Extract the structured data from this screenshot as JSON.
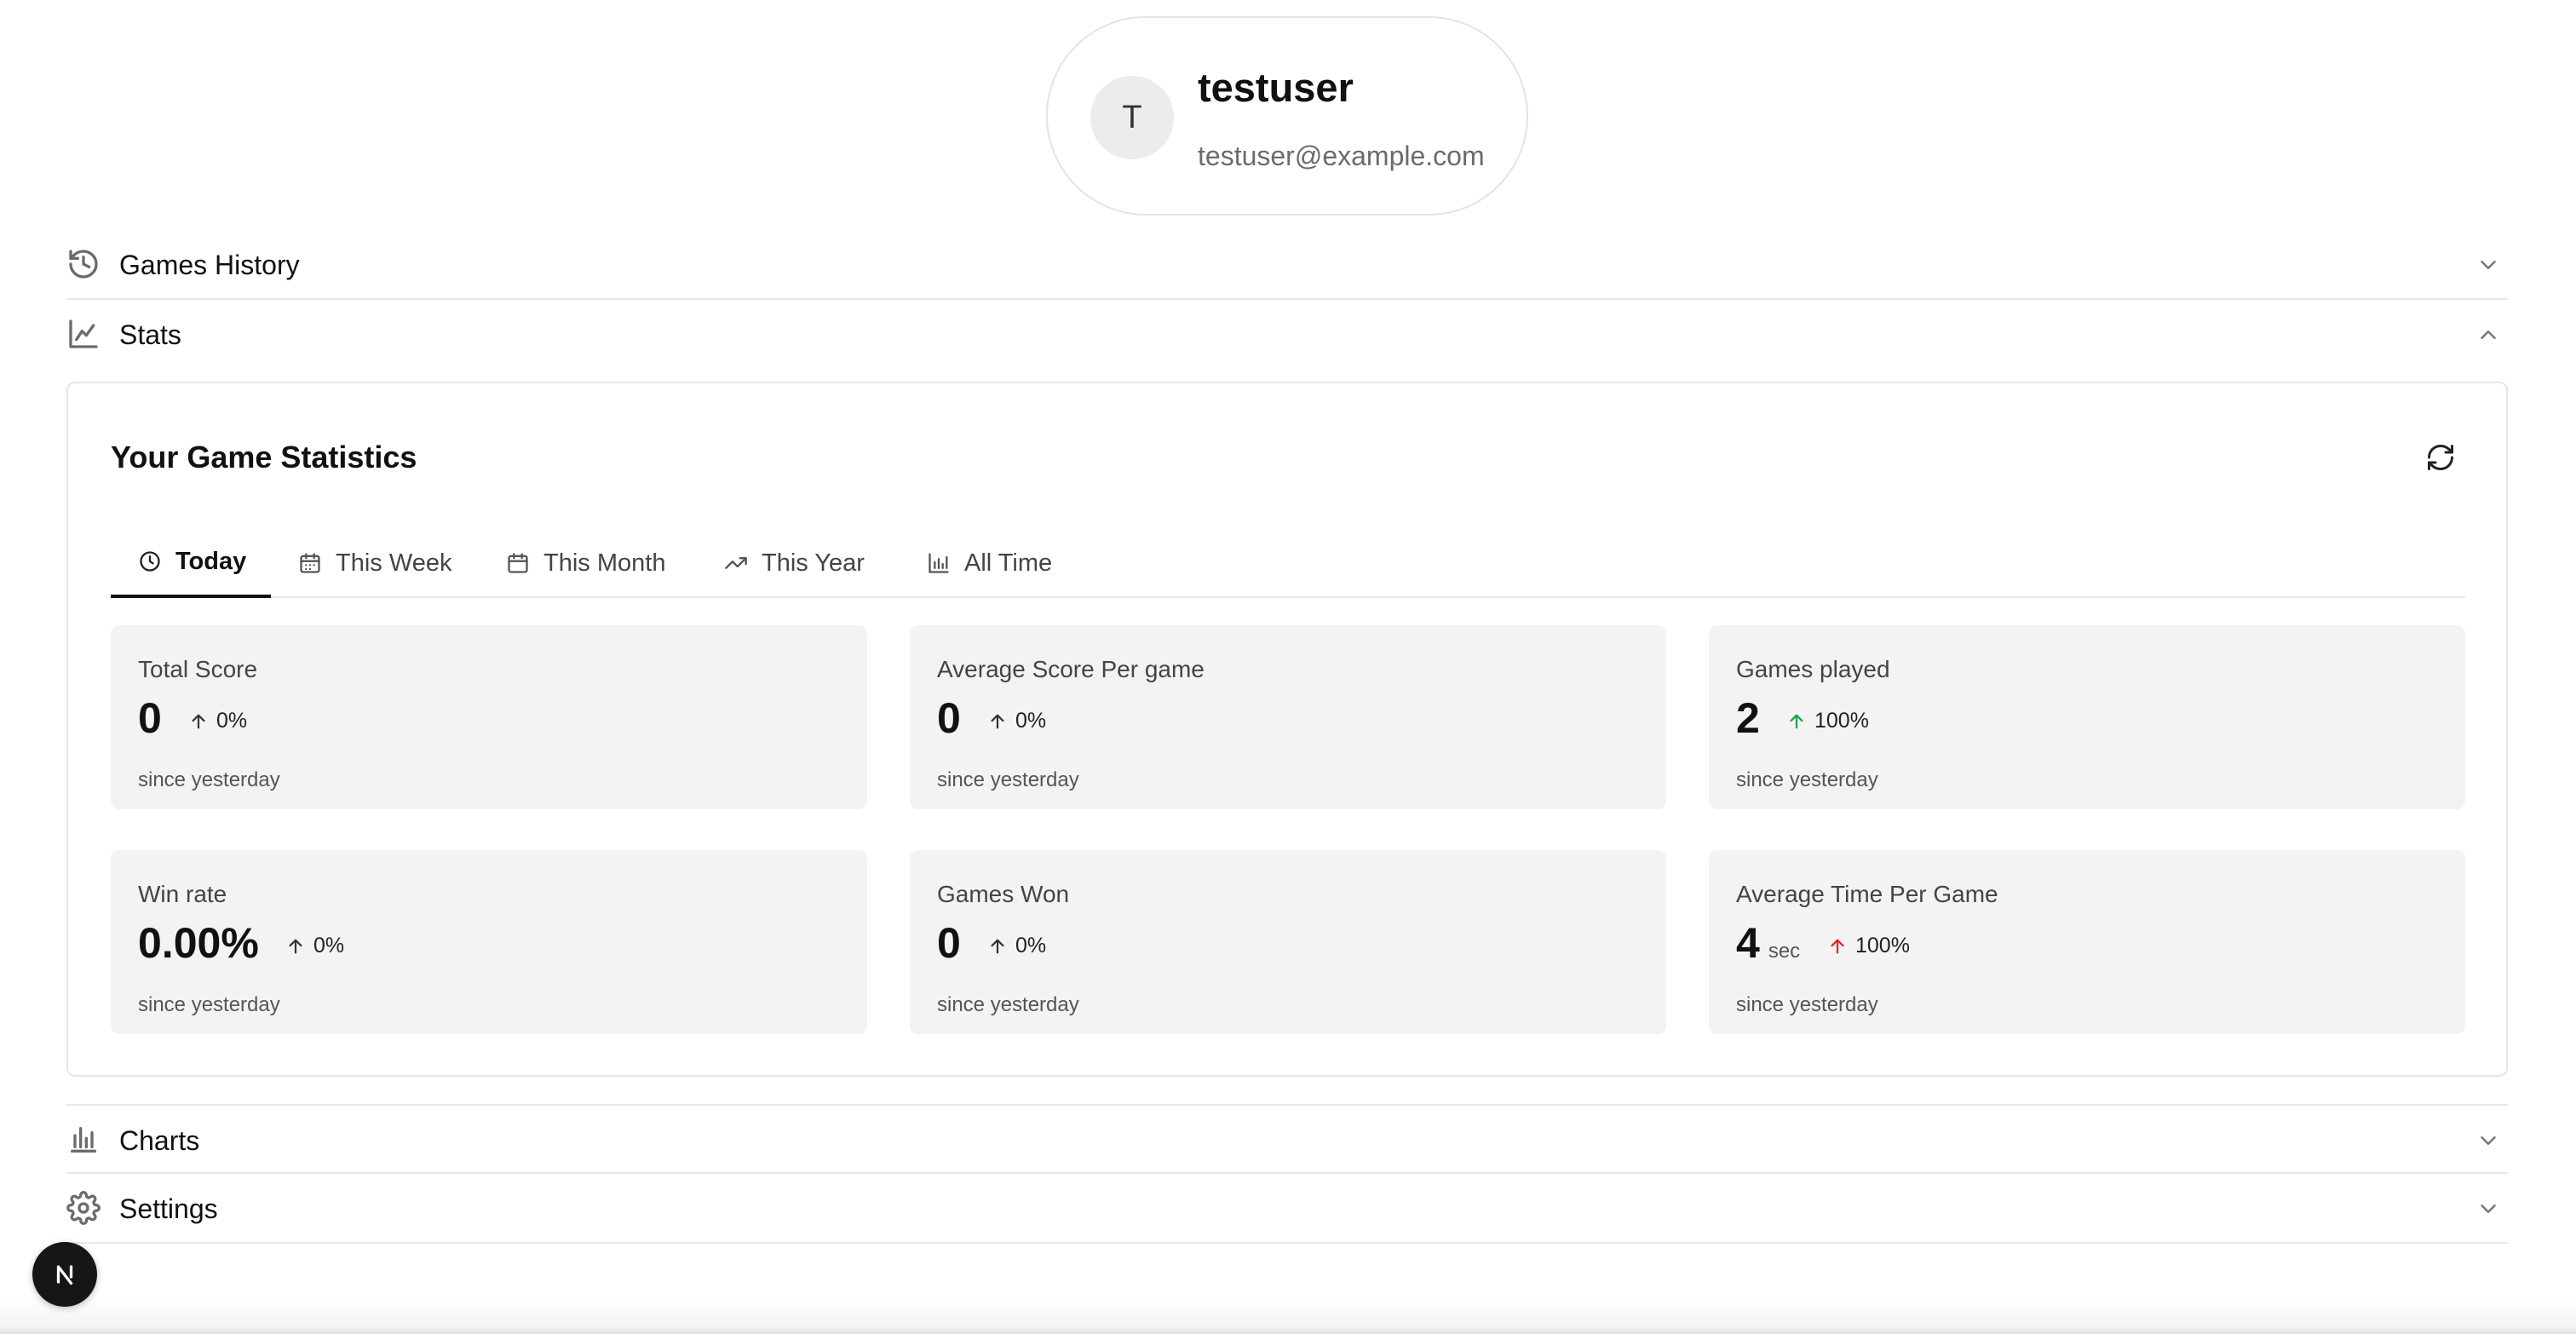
{
  "profile": {
    "avatar_letter": "T",
    "username": "testuser",
    "email": "testuser@example.com"
  },
  "sections": {
    "games_history": {
      "label": "Games History",
      "icon": "history-icon"
    },
    "stats": {
      "label": "Stats",
      "icon": "line-chart-icon"
    },
    "charts": {
      "label": "Charts",
      "icon": "bar-chart-icon"
    },
    "settings": {
      "label": "Settings",
      "icon": "gear-icon"
    }
  },
  "stats_panel": {
    "title": "Your Game Statistics",
    "tabs": [
      {
        "label": "Today",
        "icon": "clock-icon",
        "active": true
      },
      {
        "label": "This Week",
        "icon": "calendar-icon",
        "active": false
      },
      {
        "label": "This Month",
        "icon": "calendar-icon",
        "active": false
      },
      {
        "label": "This Year",
        "icon": "trending-up-icon",
        "active": false
      },
      {
        "label": "All Time",
        "icon": "bar-chart-icon",
        "active": false
      }
    ],
    "cards": [
      {
        "label": "Total Score",
        "value": "0",
        "unit": "",
        "change": "0%",
        "direction": "up",
        "color": "#333333",
        "sub": "since yesterday"
      },
      {
        "label": "Average Score Per game",
        "value": "0",
        "unit": "",
        "change": "0%",
        "direction": "up",
        "color": "#333333",
        "sub": "since yesterday"
      },
      {
        "label": "Games played",
        "value": "2",
        "unit": "",
        "change": "100%",
        "direction": "up",
        "color": "#16a34a",
        "sub": "since yesterday"
      },
      {
        "label": "Win rate",
        "value": "0.00%",
        "unit": "",
        "change": "0%",
        "direction": "up",
        "color": "#333333",
        "sub": "since yesterday"
      },
      {
        "label": "Games Won",
        "value": "0",
        "unit": "",
        "change": "0%",
        "direction": "up",
        "color": "#333333",
        "sub": "since yesterday"
      },
      {
        "label": "Average Time Per Game",
        "value": "4",
        "unit": "sec",
        "change": "100%",
        "direction": "up",
        "color": "#dc2626",
        "sub": "since yesterday"
      }
    ]
  },
  "dev_badge": {
    "letter": "N"
  }
}
